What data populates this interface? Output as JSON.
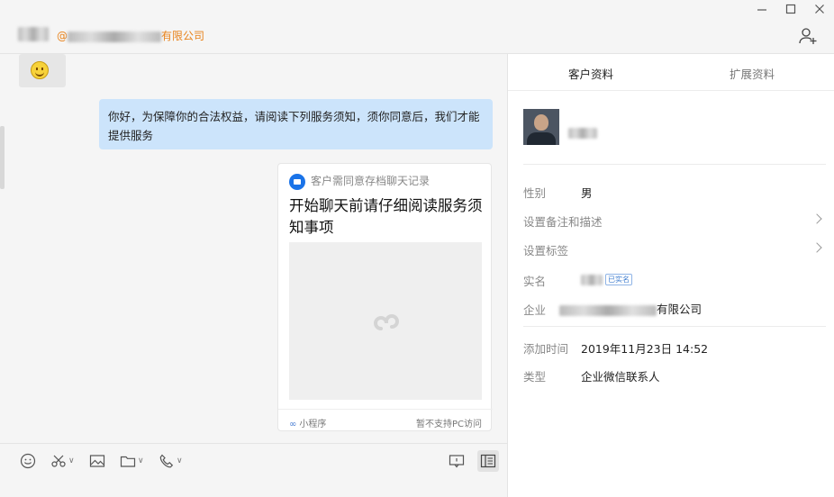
{
  "window": {
    "minimize_icon": "minimize-icon",
    "maximize_icon": "maximize-icon",
    "close_icon": "close-icon"
  },
  "header": {
    "org_suffix": "有限公司",
    "at_prefix": "@"
  },
  "chat": {
    "messages": [
      {
        "type": "emoji",
        "icon": "smiley-emoji"
      },
      {
        "type": "text",
        "text": "你好，为保障你的合法权益，请阅读下列服务须知，须你同意后，我们才能提供服务"
      },
      {
        "type": "mini-program",
        "source_label": "客户需同意存档聊天记录",
        "title": "开始聊天前请仔细阅读服务须知事项",
        "footer_left": "小程序",
        "footer_right": "暂不支持PC访问"
      }
    ]
  },
  "toolbar": {
    "icons": [
      "emoji-icon",
      "scissors-icon",
      "image-icon",
      "folder-icon",
      "phone-icon",
      "message-box-icon",
      "side-panel-icon"
    ]
  },
  "profile": {
    "tabs": [
      {
        "label": "客户资料",
        "active": true
      },
      {
        "label": "扩展资料",
        "active": false
      }
    ],
    "fields": {
      "gender_label": "性别",
      "gender_value": "男",
      "remark_label": "设置备注和描述",
      "tag_label": "设置标签",
      "realname_label": "实名",
      "realname_badge": "已实名",
      "company_label": "企业",
      "company_suffix": "有限公司",
      "added_label": "添加时间",
      "added_value": "2019年11月23日 14:52",
      "type_label": "类型",
      "type_value": "企业微信联系人"
    }
  }
}
